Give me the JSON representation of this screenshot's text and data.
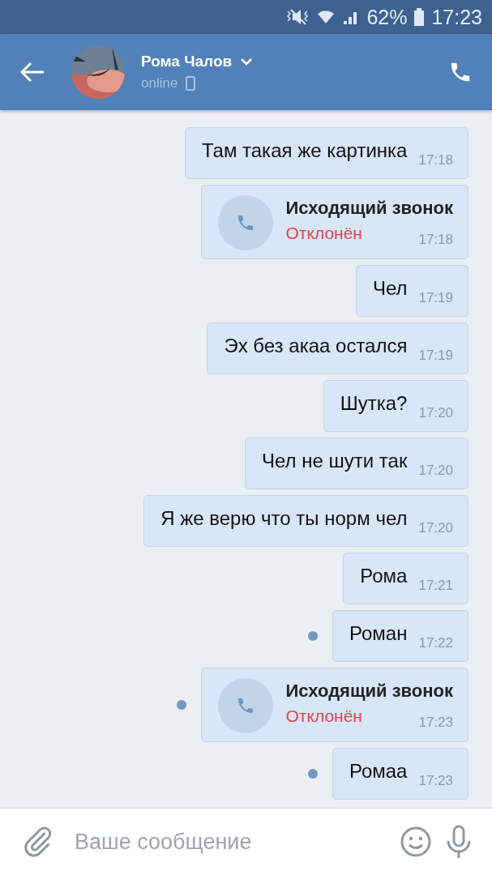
{
  "status_bar": {
    "battery": "62%",
    "time": "17:23"
  },
  "header": {
    "name": "Рома Чалов",
    "status": "online"
  },
  "messages": [
    {
      "kind": "text",
      "text": "Там такая же картинка",
      "time": "17:18",
      "unread": false
    },
    {
      "kind": "call",
      "title": "Исходящий звонок",
      "result": "Отклонён",
      "time": "17:18",
      "unread": false
    },
    {
      "kind": "text",
      "text": "Чел",
      "time": "17:19",
      "unread": false
    },
    {
      "kind": "text",
      "text": "Эх без акаа остался",
      "time": "17:19",
      "unread": false
    },
    {
      "kind": "text",
      "text": "Шутка?",
      "time": "17:20",
      "unread": false
    },
    {
      "kind": "text",
      "text": "Чел не шути так",
      "time": "17:20",
      "unread": false
    },
    {
      "kind": "text",
      "text": "Я же верю что ты норм чел",
      "time": "17:20",
      "unread": false
    },
    {
      "kind": "text",
      "text": "Рома",
      "time": "17:21",
      "unread": false
    },
    {
      "kind": "text",
      "text": "Роман",
      "time": "17:22",
      "unread": true
    },
    {
      "kind": "call",
      "title": "Исходящий звонок",
      "result": "Отклонён",
      "time": "17:23",
      "unread": true
    },
    {
      "kind": "text",
      "text": "Ромаа",
      "time": "17:23",
      "unread": true
    }
  ],
  "composer": {
    "placeholder": "Ваше сообщение"
  }
}
